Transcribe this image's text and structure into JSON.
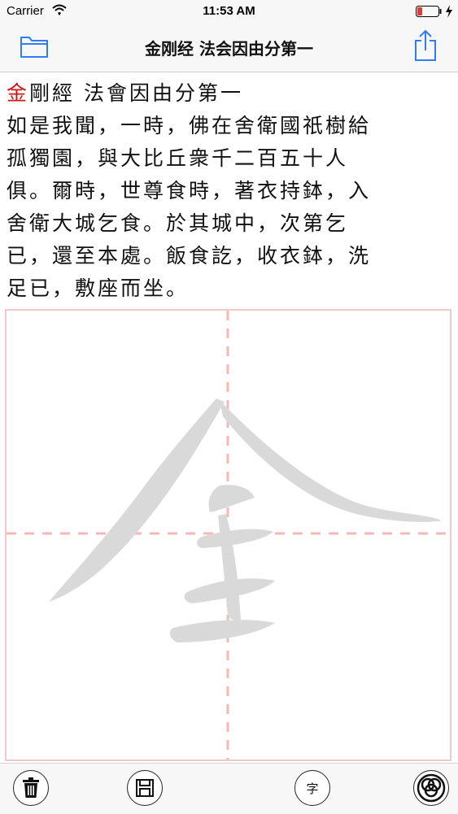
{
  "status_bar": {
    "carrier": "Carrier",
    "time": "11:53 AM",
    "battery_color": "#e53935"
  },
  "nav": {
    "title": "金刚经 法会因由分第一",
    "folder_icon": "folder-icon",
    "share_icon": "share-icon",
    "accent_color": "#2f7cf6"
  },
  "text": {
    "current_char": "金",
    "lines": [
      "剛經 法會因由分第一",
      "如是我聞，一時，佛在舍衛國祇樹給",
      "孤獨園，與大比丘衆千二百五十人",
      "俱。爾時，世尊食時，著衣持鉢，入",
      "舍衛大城乞食。於其城中，次第乞",
      "已，還至本處。飯食訖，收衣鉢，洗",
      "足已，敷座而坐。"
    ]
  },
  "practice": {
    "guide_char": "金",
    "guide_color": "#d8d8d8",
    "grid_color": "#f4b8b8"
  },
  "toolbar": {
    "trash_icon": "trash-icon",
    "save_icon": "save-icon",
    "char_label": "字",
    "circles_icon": "circles-icon"
  }
}
